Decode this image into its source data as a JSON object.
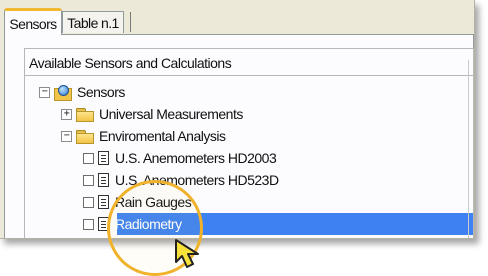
{
  "tabs": [
    {
      "label": "Sensors",
      "active": true
    },
    {
      "label": "Table n.1",
      "active": false
    }
  ],
  "group": {
    "title": "Available Sensors and Calculations"
  },
  "tree": {
    "root": {
      "label": "Sensors",
      "expander": "⊟",
      "icon": "sensors-folder-icon"
    },
    "items": [
      {
        "label": "Universal Measurements",
        "expander": "+",
        "icon": "folder-icon"
      },
      {
        "label": "Enviromental Analysis",
        "expander": "−",
        "icon": "folder-icon"
      },
      {
        "label": "U.S. Anemometers HD2003",
        "icon": "document-icon"
      },
      {
        "label": "U.S. Anemometers HD523D",
        "icon": "document-icon"
      },
      {
        "label": "Rain Gauges",
        "icon": "document-icon"
      },
      {
        "label": "Radiometry",
        "icon": "document-icon",
        "selected": true
      }
    ]
  },
  "colors": {
    "selection": "#3d81f2",
    "tab_accent": "#f1b830",
    "highlight_ring": "#f1b22b",
    "cursor": "#f8e23a"
  }
}
